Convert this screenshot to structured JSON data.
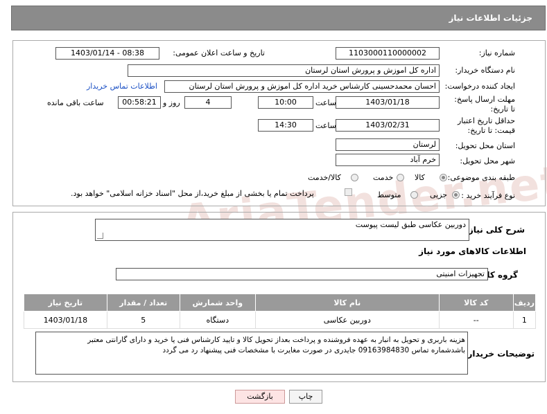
{
  "header": {
    "title": "جزئیات اطلاعات نیاز"
  },
  "watermark": "AriaTender.net",
  "form": {
    "need_number": {
      "label": "شماره نیاز:",
      "value": "1103000110000002"
    },
    "announce": {
      "label": "تاریخ و ساعت اعلان عمومی:",
      "value": "1403/01/14 - 08:38"
    },
    "buyer_org": {
      "label": "نام دستگاه خریدار:",
      "value": "اداره کل اموزش و پرورش استان لرستان"
    },
    "creator": {
      "label": "ایجاد کننده درخواست:",
      "value": "احسان محمدحسینی کارشناس خرید اداره کل اموزش و پرورش استان لرستان",
      "contact_link": "اطلاعات تماس خریدار"
    },
    "reply_deadline": {
      "label": "مهلت ارسال پاسخ: تا تاریخ:",
      "date": "1403/01/18",
      "time_label": "ساعت",
      "time": "10:00",
      "days": "4",
      "days_label": "روز و",
      "remaining": "00:58:21",
      "remaining_label": "ساعت باقی مانده"
    },
    "price_validity": {
      "label": "حداقل تاریخ اعتبار قیمت: تا تاریخ:",
      "date": "1403/02/31",
      "time_label": "ساعت",
      "time": "14:30"
    },
    "province": {
      "label": "استان محل تحویل:",
      "value": "لرستان"
    },
    "city": {
      "label": "شهر محل تحویل:",
      "value": "خرم آباد"
    },
    "category": {
      "label": "طبقه بندی موضوعی:",
      "options": [
        "کالا",
        "خدمت",
        "کالا/خدمت"
      ],
      "selected": "کالا"
    },
    "purchase_type": {
      "label": "نوع فرآیند خرید :",
      "options": [
        "جزیی",
        "متوسط"
      ],
      "selected": "جزیی",
      "note": "پرداخت تمام یا بخشی از مبلغ خرید،از محل \"اسناد خزانه اسلامی\" خواهد بود."
    }
  },
  "description": {
    "label": "شرح کلی نیاز:",
    "value": "دوربین عکاسی طبق لیست پیوست"
  },
  "goods_section": {
    "title": "اطلاعات کالاهای مورد نیاز",
    "group_label": "گروه کالا:",
    "group_value": "تجهیزات امنیتی"
  },
  "table": {
    "headers": [
      "ردیف",
      "کد کالا",
      "نام کالا",
      "واحد شمارش",
      "تعداد / مقدار",
      "تاریخ نیاز"
    ],
    "rows": [
      [
        "1",
        "--",
        "دوربین عکاسی",
        "دستگاه",
        "5",
        "1403/01/18"
      ]
    ]
  },
  "buyer_notes": {
    "label": "توضیحات خریدار:",
    "line1": "هزینه باربری و تحویل به انبار به عهده فروشنده و پرداخت بعداز تحویل کالا و تایید کارشناس فنی یا خرید  و دارای گارانتی معتبر",
    "line2": "باشدشماره تماس 09163984830 جایدری در صورت مغایرت با مشخصات فنی پیشنهاد رد می گردد"
  },
  "buttons": {
    "print": "چاپ",
    "back": "بازگشت"
  }
}
